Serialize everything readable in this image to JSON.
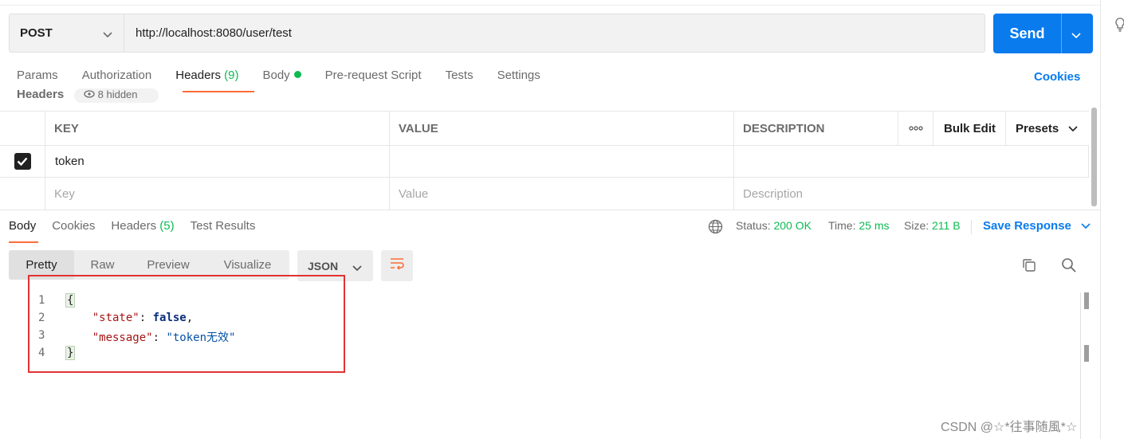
{
  "request": {
    "method": "POST",
    "url": "http://localhost:8080/user/test",
    "send_label": "Send"
  },
  "request_tabs": [
    {
      "label": "Params"
    },
    {
      "label": "Authorization"
    },
    {
      "label": "Headers",
      "count": "(9)"
    },
    {
      "label": "Body"
    },
    {
      "label": "Pre-request Script"
    },
    {
      "label": "Tests"
    },
    {
      "label": "Settings"
    }
  ],
  "cookies_link": "Cookies",
  "headers_section": {
    "title": "Headers",
    "hidden_label": "8 hidden"
  },
  "headers_table": {
    "columns": [
      "KEY",
      "VALUE",
      "DESCRIPTION"
    ],
    "bulk_edit": "Bulk Edit",
    "presets": "Presets",
    "rows": [
      {
        "checked": true,
        "key": "token",
        "value": "",
        "description": ""
      }
    ],
    "placeholders": {
      "key": "Key",
      "value": "Value",
      "description": "Description"
    }
  },
  "response_tabs": [
    {
      "label": "Body"
    },
    {
      "label": "Cookies"
    },
    {
      "label": "Headers",
      "count": "(5)"
    },
    {
      "label": "Test Results"
    }
  ],
  "response_meta": {
    "status_label": "Status:",
    "status_value": "200 OK",
    "time_label": "Time:",
    "time_value": "25 ms",
    "size_label": "Size:",
    "size_value": "211 B",
    "save_response": "Save Response"
  },
  "view_modes": [
    "Pretty",
    "Raw",
    "Preview",
    "Visualize"
  ],
  "format": "JSON",
  "code_lines": [
    {
      "num": "1"
    },
    {
      "num": "2",
      "key": "\"state\"",
      "value": "false"
    },
    {
      "num": "3",
      "key": "\"message\"",
      "value": "\"token无效\""
    },
    {
      "num": "4"
    }
  ],
  "watermark": "CSDN @☆*往事随風*☆",
  "colors": {
    "accent_blue": "#097bed",
    "accent_orange": "#ff6c37",
    "success_green": "#0cbb52",
    "highlight_red": "#e03333"
  }
}
